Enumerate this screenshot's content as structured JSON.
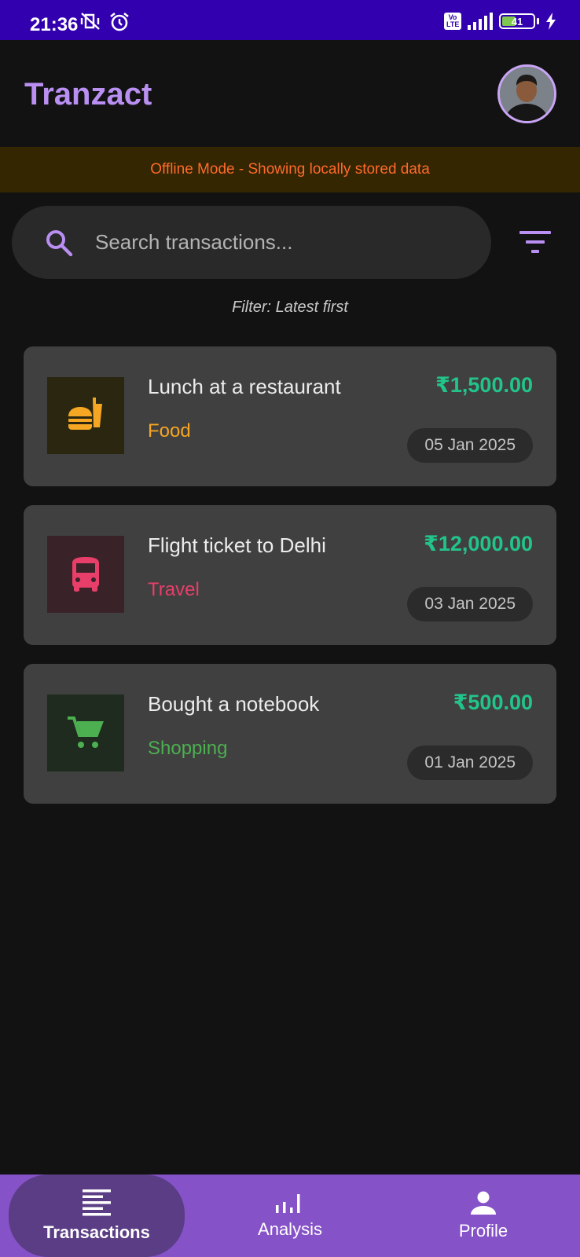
{
  "status_bar": {
    "time": "21:36",
    "battery": "41",
    "battery_level": 0.41,
    "network_badge": "Vo LTE"
  },
  "header": {
    "title": "Tranzact"
  },
  "banner": {
    "text": "Offline Mode - Showing locally stored data"
  },
  "search": {
    "placeholder": "Search transactions..."
  },
  "filter": {
    "label": "Filter: Latest first"
  },
  "transactions": [
    {
      "title": "Lunch at a restaurant",
      "category": "Food",
      "amount": "₹1,500.00",
      "date": "05 Jan 2025",
      "icon": "fastfood-icon",
      "color": "#f5a623"
    },
    {
      "title": "Flight ticket to Delhi",
      "category": "Travel",
      "amount": "₹12,000.00",
      "date": "03 Jan 2025",
      "icon": "bus-icon",
      "color": "#e83e6a"
    },
    {
      "title": "Bought a notebook",
      "category": "Shopping",
      "amount": "₹500.00",
      "date": "01 Jan 2025",
      "icon": "cart-icon",
      "color": "#4caf50"
    }
  ],
  "nav": [
    {
      "label": "Transactions",
      "icon": "list-icon",
      "active": true
    },
    {
      "label": "Analysis",
      "icon": "bar-chart-icon",
      "active": false
    },
    {
      "label": "Profile",
      "icon": "person-icon",
      "active": false
    }
  ],
  "colors": {
    "accent": "#b98ff2",
    "amount": "#22c48a",
    "nav_bg": "#8552c8",
    "status_bar": "#3300b0",
    "banner_text": "#ff6a2c"
  }
}
